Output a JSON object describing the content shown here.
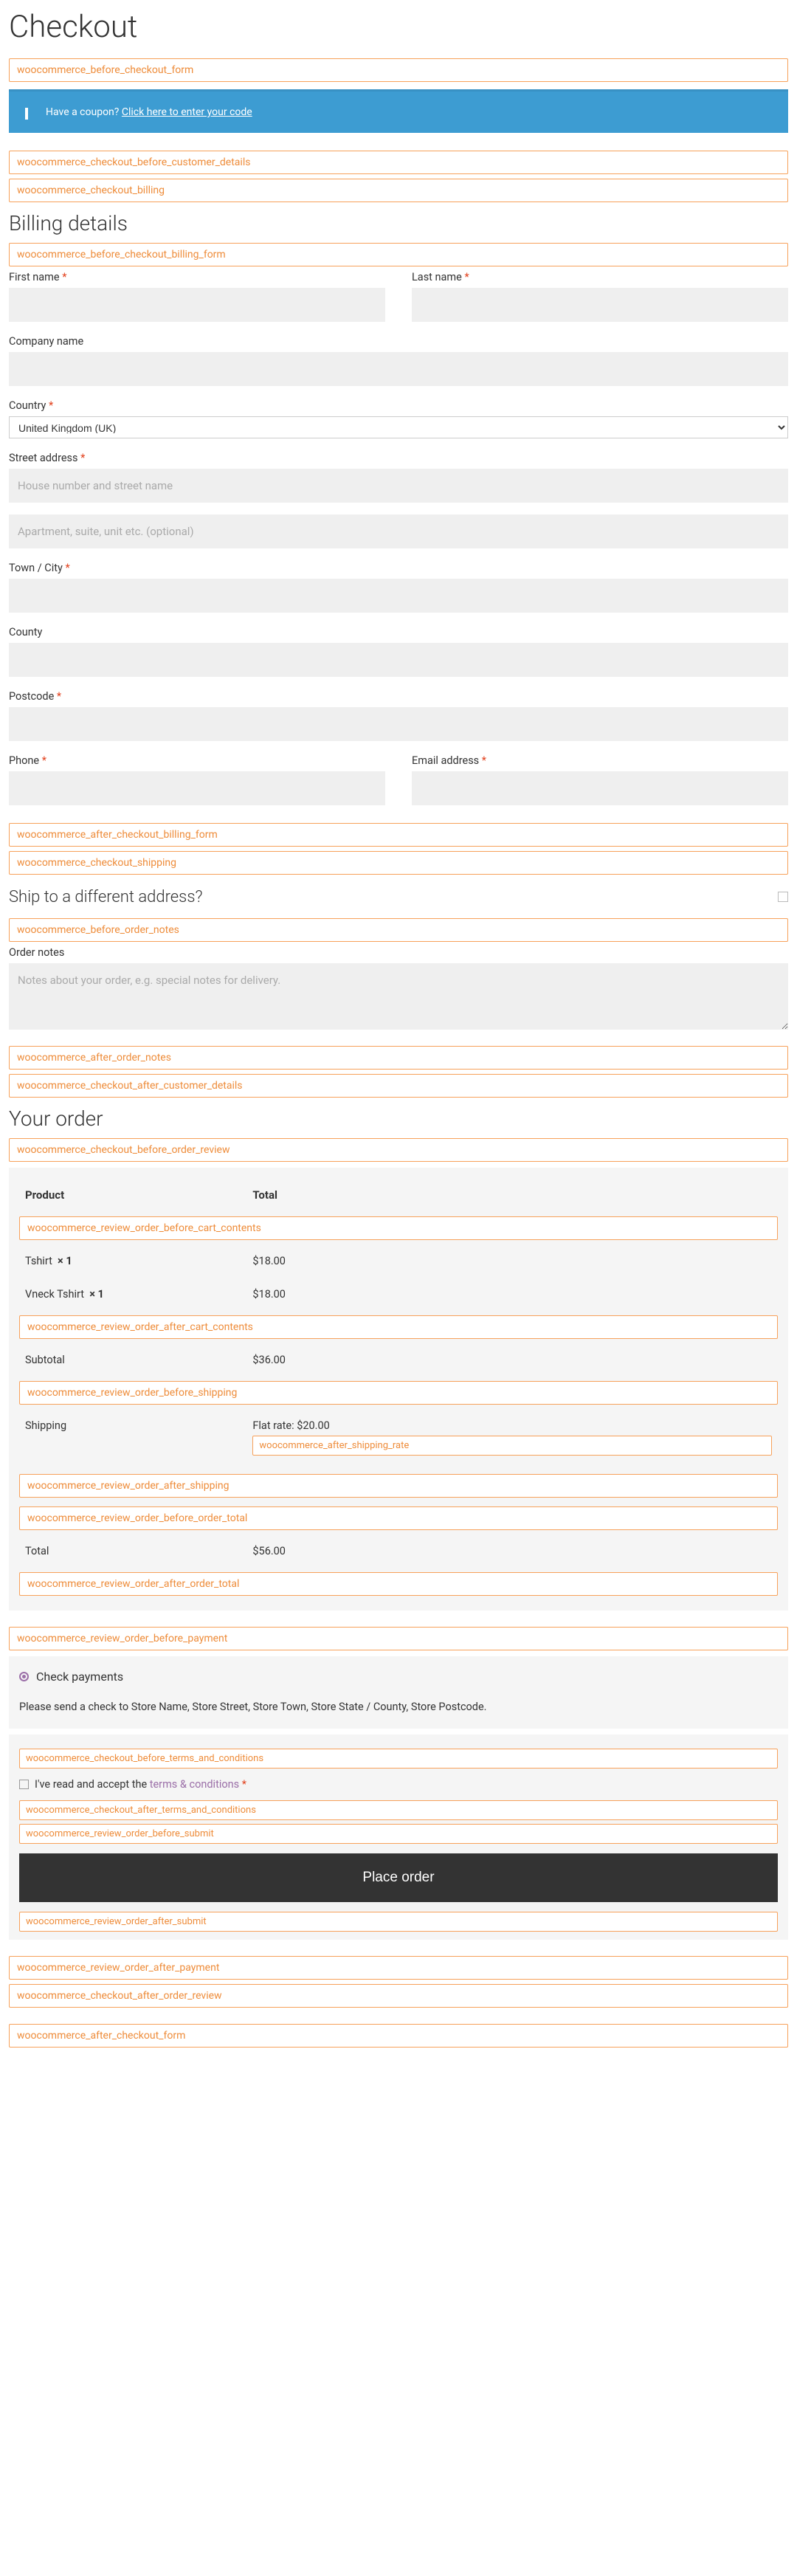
{
  "page_title": "Checkout",
  "hooks": {
    "before_checkout_form": "woocommerce_before_checkout_form",
    "coupon_text": "Have a coupon?",
    "coupon_link": "Click here to enter your code",
    "checkout_before_customer": "woocommerce_checkout_before_customer_details",
    "checkout_billing": "woocommerce_checkout_billing",
    "billing_heading": "Billing details",
    "before_billing_form": "woocommerce_before_checkout_billing_form",
    "after_billing_form": "woocommerce_after_checkout_billing_form",
    "checkout_shipping": "woocommerce_checkout_shipping",
    "ship_heading": "Ship to a different address?",
    "before_order_notes": "woocommerce_before_order_notes",
    "after_order_notes": "woocommerce_after_order_notes",
    "checkout_after_customer": "woocommerce_checkout_after_customer_details",
    "order_heading": "Your order",
    "before_order_review": "woocommerce_checkout_before_order_review",
    "review_before_cart": "woocommerce_review_order_before_cart_contents",
    "review_after_cart": "woocommerce_review_order_after_cart_contents",
    "review_before_ship": "woocommerce_review_order_before_shipping",
    "after_shipping_rate": "woocommerce_after_shipping_rate",
    "review_after_ship": "woocommerce_review_order_after_shipping",
    "review_before_total": "woocommerce_review_order_before_order_total",
    "review_after_total": "woocommerce_review_order_after_order_total",
    "review_before_payment": "woocommerce_review_order_before_payment",
    "checkout_before_terms": "woocommerce_checkout_before_terms_and_conditions",
    "checkout_after_terms": "woocommerce_checkout_after_terms_and_conditions",
    "review_before_submit": "woocommerce_review_order_before_submit",
    "review_after_submit": "woocommerce_review_order_after_submit",
    "review_after_payment": "woocommerce_review_order_after_payment",
    "after_order_review": "woocommerce_checkout_after_order_review",
    "after_checkout_form": "woocommerce_after_checkout_form"
  },
  "billing": {
    "first_name": "First name",
    "last_name": "Last name",
    "company": "Company name",
    "country": "Country",
    "country_value": "United Kingdom (UK)",
    "street": "Street address",
    "street_ph1": "House number and street name",
    "street_ph2": "Apartment, suite, unit etc. (optional)",
    "town": "Town / City",
    "county": "County",
    "postcode": "Postcode",
    "phone": "Phone",
    "email": "Email address"
  },
  "notes": {
    "label": "Order notes",
    "placeholder": "Notes about your order, e.g. special notes for delivery."
  },
  "order": {
    "product_hdr": "Product",
    "total_hdr": "Total",
    "items": [
      {
        "name": "Tshirt",
        "qty": "× 1",
        "price": "$18.00"
      },
      {
        "name": "Vneck Tshirt",
        "qty": "× 1",
        "price": "$18.00"
      }
    ],
    "subtotal_label": "Subtotal",
    "subtotal": "$36.00",
    "shipping_label": "Shipping",
    "shipping_value": "Flat rate: $20.00",
    "total_label": "Total",
    "total": "$56.00"
  },
  "payment": {
    "method": "Check payments",
    "desc": "Please send a check to Store Name, Store Street, Store Town, Store State / County, Store Postcode."
  },
  "terms": {
    "text_pre": "I've read and accept the ",
    "link": "terms & conditions"
  },
  "place_order": "Place order",
  "req": "*"
}
